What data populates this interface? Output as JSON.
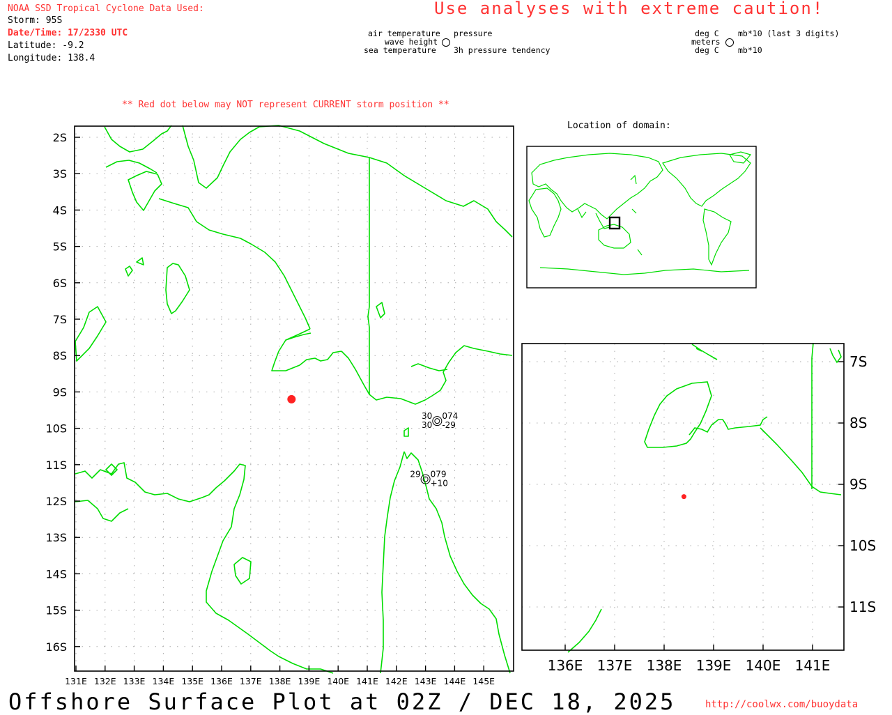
{
  "header": {
    "title": "NOAA SSD Tropical Cyclone Data Used:",
    "storm": "Storm: 95S",
    "datetime": "Date/Time: 17/2330 UTC",
    "latitude": "Latitude: -9.2",
    "longitude": "Longitude: 138.4",
    "caution": "Use analyses with extreme caution!"
  },
  "legend": {
    "air_temperature": "air temperature",
    "wave_height": "wave height",
    "sea_temperature": "sea temperature",
    "pressure": "pressure",
    "pressure_tendency": "3h pressure tendency",
    "unit_air": "deg C",
    "unit_wave": "meters",
    "unit_sea": "deg C",
    "unit_pressure": "mb*10 (last 3 digits)",
    "unit_tendency": "mb*10"
  },
  "warning": "** Red dot below may NOT represent CURRENT storm position **",
  "location_label": "Location of domain:",
  "main_map": {
    "lat_labels": [
      "2S",
      "3S",
      "4S",
      "5S",
      "6S",
      "7S",
      "8S",
      "9S",
      "10S",
      "11S",
      "12S",
      "13S",
      "14S",
      "15S",
      "16S"
    ],
    "lon_labels": [
      "131E",
      "132E",
      "133E",
      "134E",
      "135E",
      "136E",
      "137E",
      "138E",
      "139E",
      "140E",
      "141E",
      "142E",
      "143E",
      "144E",
      "145E"
    ],
    "storm_position": {
      "lat": -9.2,
      "lon": 138.4
    },
    "stations": [
      {
        "air_temp": "30",
        "pressure": "074",
        "sea_temp": "30",
        "tendency": "-29",
        "lat": -9.8,
        "lon": 143.4
      },
      {
        "air_temp": "29",
        "pressure": "079",
        "sea_temp": "",
        "tendency": "+10",
        "lat": -11.4,
        "lon": 143.0
      }
    ],
    "colors": {
      "coast": "#00dd00",
      "storm": "#ff2222",
      "grid": "#aaaaaa"
    }
  },
  "zoom_map": {
    "lat_labels": [
      "7S",
      "8S",
      "9S",
      "10S",
      "11S"
    ],
    "lon_labels": [
      "136E",
      "137E",
      "138E",
      "139E",
      "140E",
      "141E"
    ]
  },
  "footer": {
    "title": "Offshore Surface Plot at 02Z / DEC 18, 2025",
    "url": "http://coolwx.com/buoydata"
  }
}
